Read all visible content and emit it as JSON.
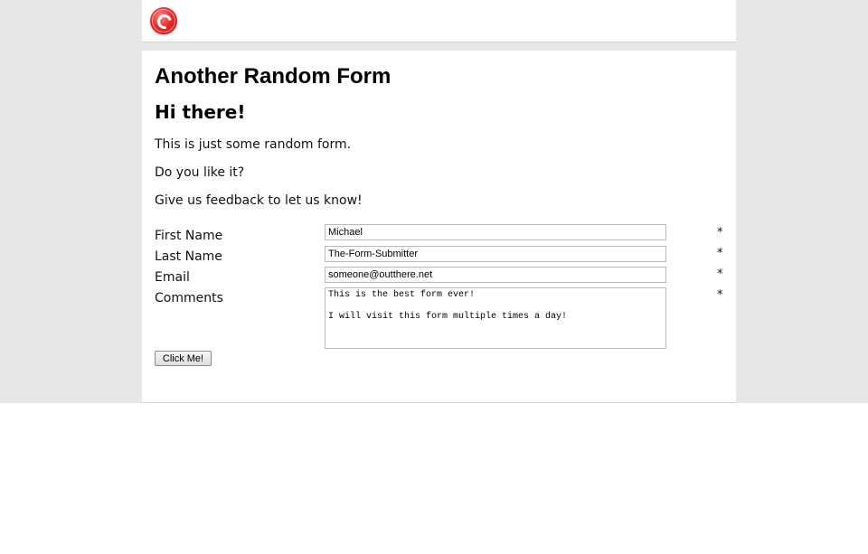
{
  "header": {
    "logo_icon": "red-circular-logo-icon"
  },
  "form": {
    "title": "Another Random Form",
    "greeting": "Hi there!",
    "paragraphs": [
      "This is just some random form.",
      "Do you like it?",
      "Give us feedback to let us know!"
    ],
    "fields": {
      "first_name": {
        "label": "First Name",
        "value": "Michael",
        "required_mark": "*"
      },
      "last_name": {
        "label": "Last Name",
        "value": "The-Form-Submitter",
        "required_mark": "*"
      },
      "email": {
        "label": "Email",
        "value": "someone@outthere.net",
        "required_mark": "*"
      },
      "comments": {
        "label": "Comments",
        "value": "This is the best form ever!\n\nI will visit this form multiple times a day!",
        "required_mark": "*"
      }
    },
    "submit_label": "Click Me!"
  },
  "colors": {
    "page_background": "#e7e7e7",
    "card_background": "#ffffff",
    "logo_red": "#e52a2a"
  }
}
